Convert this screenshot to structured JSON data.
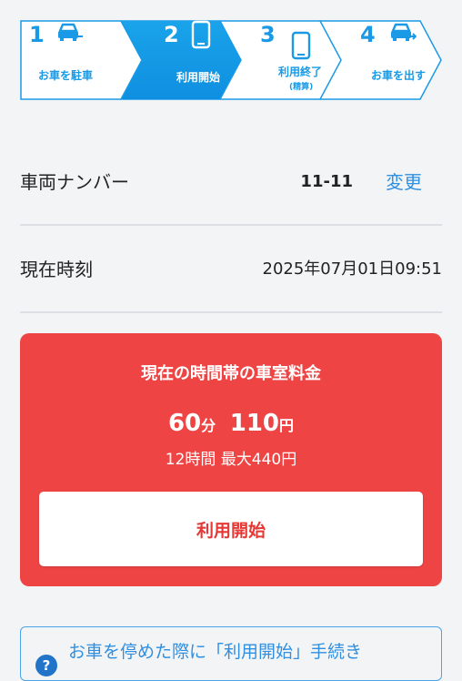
{
  "stepper": {
    "steps": [
      {
        "num": "1",
        "label": "お車を駐車",
        "sub": "",
        "icon": "car-park-icon",
        "active": false
      },
      {
        "num": "2",
        "label": "利用開始",
        "sub": "",
        "icon": "smartphone-icon",
        "active": true
      },
      {
        "num": "3",
        "label": "利用終了",
        "sub": "(精算)",
        "icon": "smartphone-icon",
        "active": false
      },
      {
        "num": "4",
        "label": "お車を出す",
        "sub": "",
        "icon": "car-exit-icon",
        "active": false
      }
    ],
    "colors": {
      "accent": "#1a9ae6",
      "active_start": "#1aa3ea",
      "active_end": "#0f8fe0"
    }
  },
  "vehicle": {
    "label": "車両ナンバー",
    "value": "11-11",
    "change_label": "変更"
  },
  "time": {
    "label": "現在時刻",
    "value": "2025年07月01日09:51"
  },
  "price_card": {
    "title": "現在の時間帯の車室料金",
    "minutes": "60",
    "minutes_unit": "分",
    "price": "110",
    "price_unit": "円",
    "max_text": "12時間 最大440円",
    "button_label": "利用開始",
    "color": "#ef4444"
  },
  "notice": {
    "text": "お車を停めた際に「利用開始」手続き",
    "icon": "question-icon",
    "icon_char": "?"
  }
}
